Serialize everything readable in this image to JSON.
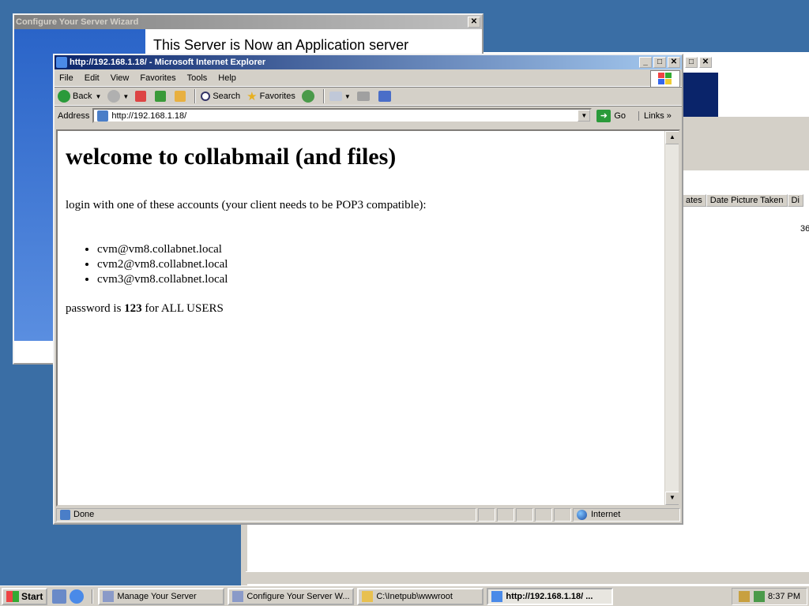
{
  "wizard": {
    "title": "Configure Your Server Wizard",
    "heading": "This Server is Now an Application server"
  },
  "explorer": {
    "columns": [
      "ates",
      "Date Picture Taken",
      "Di"
    ],
    "value": "36"
  },
  "ie": {
    "title": "http://192.168.1.18/ - Microsoft Internet Explorer",
    "menu": [
      "File",
      "Edit",
      "View",
      "Favorites",
      "Tools",
      "Help"
    ],
    "toolbar": {
      "back": "Back",
      "search": "Search",
      "favorites": "Favorites"
    },
    "address": {
      "label": "Address",
      "url": "http://192.168.1.18/",
      "go": "Go",
      "links": "Links"
    },
    "status": {
      "text": "Done",
      "zone": "Internet"
    }
  },
  "page": {
    "heading": "welcome to collabmail (and files)",
    "intro": "login with one of these accounts (your client needs to be POP3 compatible):",
    "accounts": [
      "cvm@vm8.collabnet.local",
      "cvm2@vm8.collabnet.local",
      "cvm3@vm8.collabnet.local"
    ],
    "password_prefix": "password is ",
    "password": "123",
    "password_suffix": " for ALL USERS"
  },
  "taskbar": {
    "start": "Start",
    "tasks": [
      "Manage Your Server",
      "Configure Your Server W...",
      "C:\\Inetpub\\wwwroot",
      "http://192.168.1.18/ ..."
    ],
    "clock": "8:37 PM"
  },
  "colors": {
    "desktop": "#3a6ea5",
    "title_active": "#0a246a",
    "title_inactive": "#808080"
  }
}
